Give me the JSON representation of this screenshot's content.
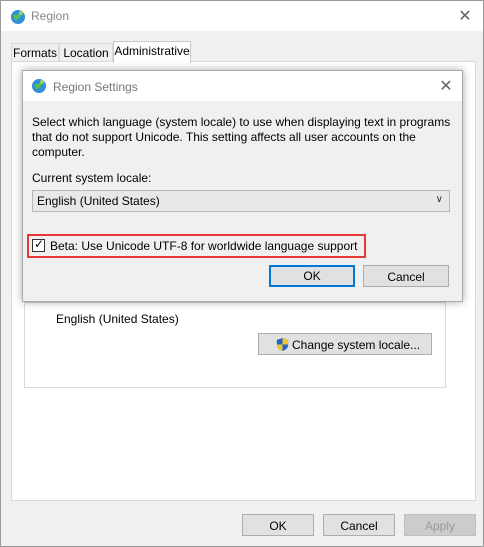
{
  "window": {
    "title": "Region",
    "close_glyph": "✕",
    "tabs": [
      "Formats",
      "Location",
      "Administrative"
    ],
    "active_tab": "Administrative"
  },
  "admin_panel": {
    "locale_value": "English (United States)",
    "change_locale_button": "Change system locale..."
  },
  "footer": {
    "ok": "OK",
    "cancel": "Cancel",
    "apply": "Apply"
  },
  "dialog": {
    "title": "Region Settings",
    "close_glyph": "✕",
    "description_lines": [
      "Select which language (system locale) to use when displaying text in programs",
      "that do not support Unicode. This setting affects all user accounts on the",
      "computer."
    ],
    "current_locale_label": "Current system locale:",
    "locale_selected": "English (United States)",
    "beta_checkbox_label": "Beta: Use Unicode UTF-8 for worldwide language support",
    "beta_checked": true,
    "ok": "OK",
    "cancel": "Cancel"
  },
  "colors": {
    "highlight": "#e53935",
    "focus": "#0078d7"
  }
}
